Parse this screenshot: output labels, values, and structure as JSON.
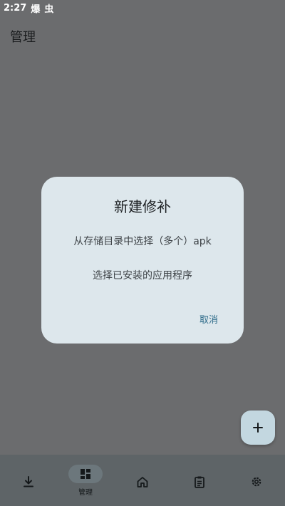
{
  "status_bar": {
    "time": "2:27",
    "indicators": [
      "爆",
      "虫"
    ]
  },
  "app": {
    "title": "管理"
  },
  "dialog": {
    "title": "新建修补",
    "option_storage": "从存储目录中选择（多个）apk",
    "option_installed": "选择已安装的应用程序",
    "cancel_label": "取消",
    "accent_color": "#2f6c8a"
  },
  "fab": {
    "icon": "plus-icon"
  },
  "nav": {
    "items": [
      {
        "icon": "download-icon",
        "label": ""
      },
      {
        "icon": "manage-grid-icon",
        "label": "管理",
        "active": true
      },
      {
        "icon": "home-icon",
        "label": ""
      },
      {
        "icon": "clipboard-icon",
        "label": ""
      },
      {
        "icon": "settings-gear-icon",
        "label": ""
      }
    ]
  }
}
